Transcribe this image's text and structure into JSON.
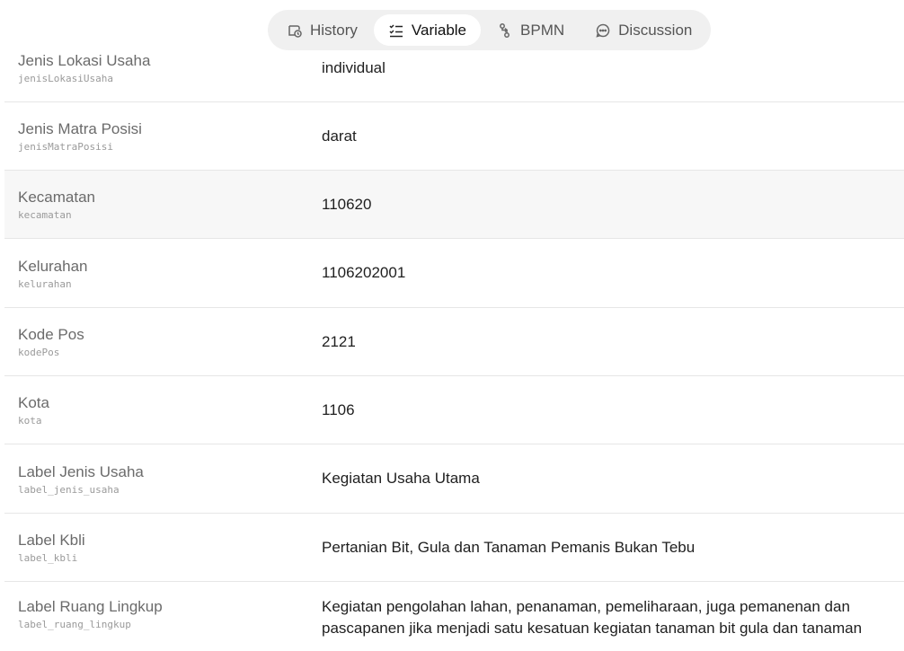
{
  "tabs": [
    {
      "label": "History",
      "icon": "history-icon",
      "active": false
    },
    {
      "label": "Variable",
      "icon": "checklist-icon",
      "active": true
    },
    {
      "label": "BPMN",
      "icon": "workflow-icon",
      "active": false
    },
    {
      "label": "Discussion",
      "icon": "chat-bubble-icon",
      "active": false
    }
  ],
  "variables": [
    {
      "label": "Jenis Lokasi Usaha",
      "key": "jenisLokasiUsaha",
      "value": "individual"
    },
    {
      "label": "Jenis Matra Posisi",
      "key": "jenisMatraPosisi",
      "value": "darat"
    },
    {
      "label": "Kecamatan",
      "key": "kecamatan",
      "value": "110620"
    },
    {
      "label": "Kelurahan",
      "key": "kelurahan",
      "value": "1106202001"
    },
    {
      "label": "Kode Pos",
      "key": "kodePos",
      "value": "2121"
    },
    {
      "label": "Kota",
      "key": "kota",
      "value": "1106"
    },
    {
      "label": "Label Jenis Usaha",
      "key": "label_jenis_usaha",
      "value": "Kegiatan Usaha Utama"
    },
    {
      "label": "Label Kbli",
      "key": "label_kbli",
      "value": "Pertanian Bit, Gula dan Tanaman Pemanis Bukan Tebu"
    },
    {
      "label": "Label Ruang Lingkup",
      "key": "label_ruang_lingkup",
      "value": "Kegiatan pengolahan lahan, penanaman, pemeliharaan, juga pemanenan dan pascapanen jika menjadi satu kesatuan kegiatan tanaman bit gula dan tanaman"
    }
  ],
  "colors": {
    "tab_bar_bg": "#f0f0f0",
    "active_tab_bg": "#ffffff",
    "row_alt_bg": "#f7f7f7"
  }
}
